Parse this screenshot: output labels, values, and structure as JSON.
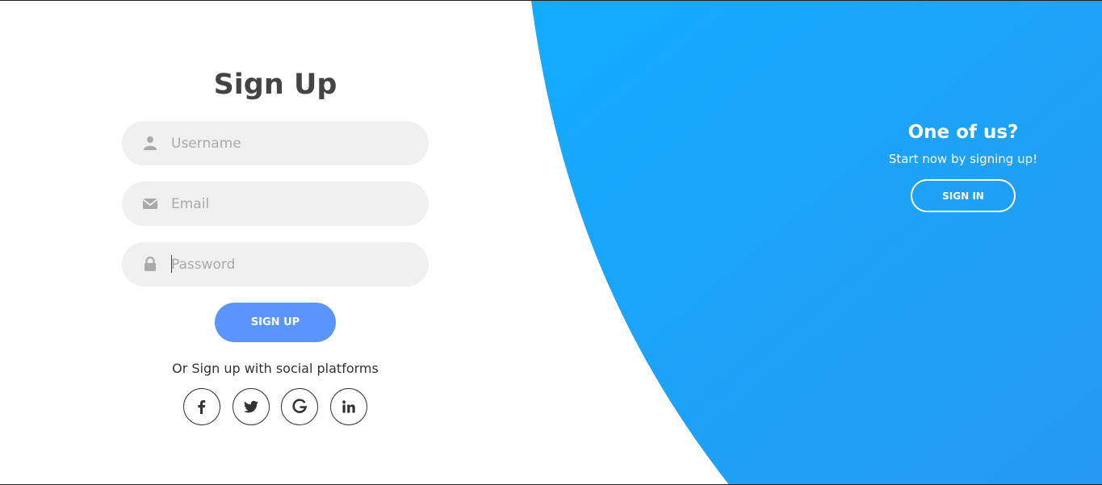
{
  "signup": {
    "title": "Sign Up",
    "username_placeholder": "Username",
    "email_placeholder": "Email",
    "password_placeholder": "Password",
    "button_label": "SIGN UP",
    "social_text": "Or Sign up with social platforms",
    "social_icons": [
      "facebook-icon",
      "twitter-icon",
      "google-icon",
      "linkedin-icon"
    ]
  },
  "panel": {
    "heading": "One of us?",
    "text": "Start now by signing up!",
    "button_label": "SIGN IN"
  },
  "colors": {
    "accent_blue": "#5995fd",
    "panel_gradient_start": "#12acff",
    "panel_gradient_end": "#2699f2",
    "input_bg": "#f0f0f0",
    "title_text": "#444444"
  }
}
